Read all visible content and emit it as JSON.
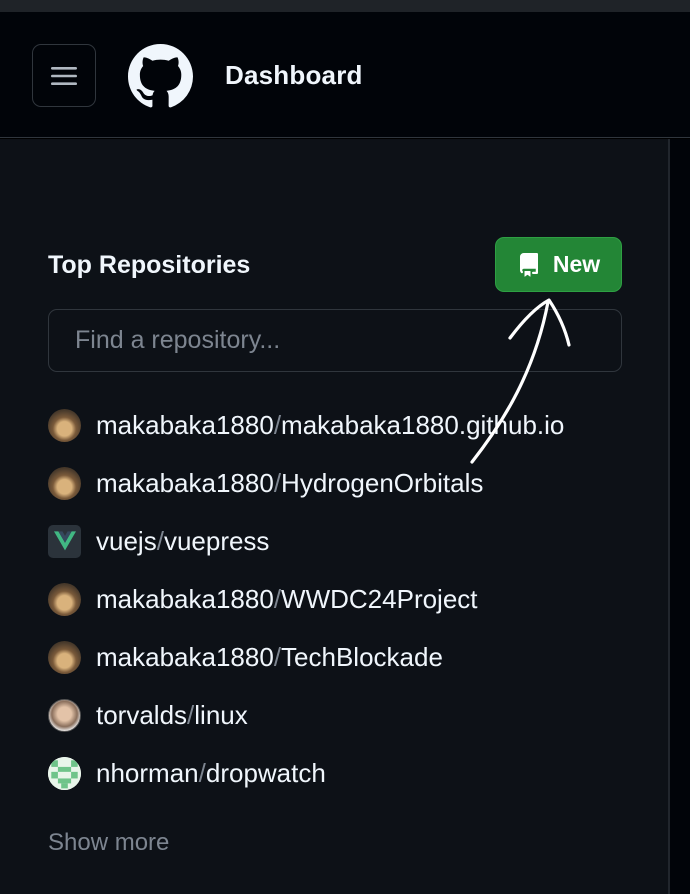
{
  "header": {
    "title": "Dashboard",
    "icons": {
      "menu": "hamburger-menu-icon",
      "logo": "github-mark-icon"
    }
  },
  "top_repositories": {
    "title": "Top Repositories",
    "new_button": {
      "label": "New",
      "icon": "repo-icon",
      "color": "#238636"
    },
    "search": {
      "placeholder": "Find a repository...",
      "value": ""
    },
    "repos": [
      {
        "owner": "makabaka1880",
        "name": "makabaka1880.github.io",
        "avatar": "makabaka1880-avatar"
      },
      {
        "owner": "makabaka1880",
        "name": "HydrogenOrbitals",
        "avatar": "makabaka1880-avatar"
      },
      {
        "owner": "vuejs",
        "name": "vuepress",
        "avatar": "vuejs-avatar"
      },
      {
        "owner": "makabaka1880",
        "name": "WWDC24Project",
        "avatar": "makabaka1880-avatar"
      },
      {
        "owner": "makabaka1880",
        "name": "TechBlockade",
        "avatar": "makabaka1880-avatar"
      },
      {
        "owner": "torvalds",
        "name": "linux",
        "avatar": "torvalds-avatar"
      },
      {
        "owner": "nhorman",
        "name": "dropwatch",
        "avatar": "nhorman-avatar"
      }
    ],
    "separator": "/",
    "show_more": "Show more"
  },
  "theme": {
    "background": "#0d1117",
    "header_background": "#010409",
    "border": "#30363d",
    "muted_text": "#7d8590",
    "text": "#f0f6fc"
  }
}
